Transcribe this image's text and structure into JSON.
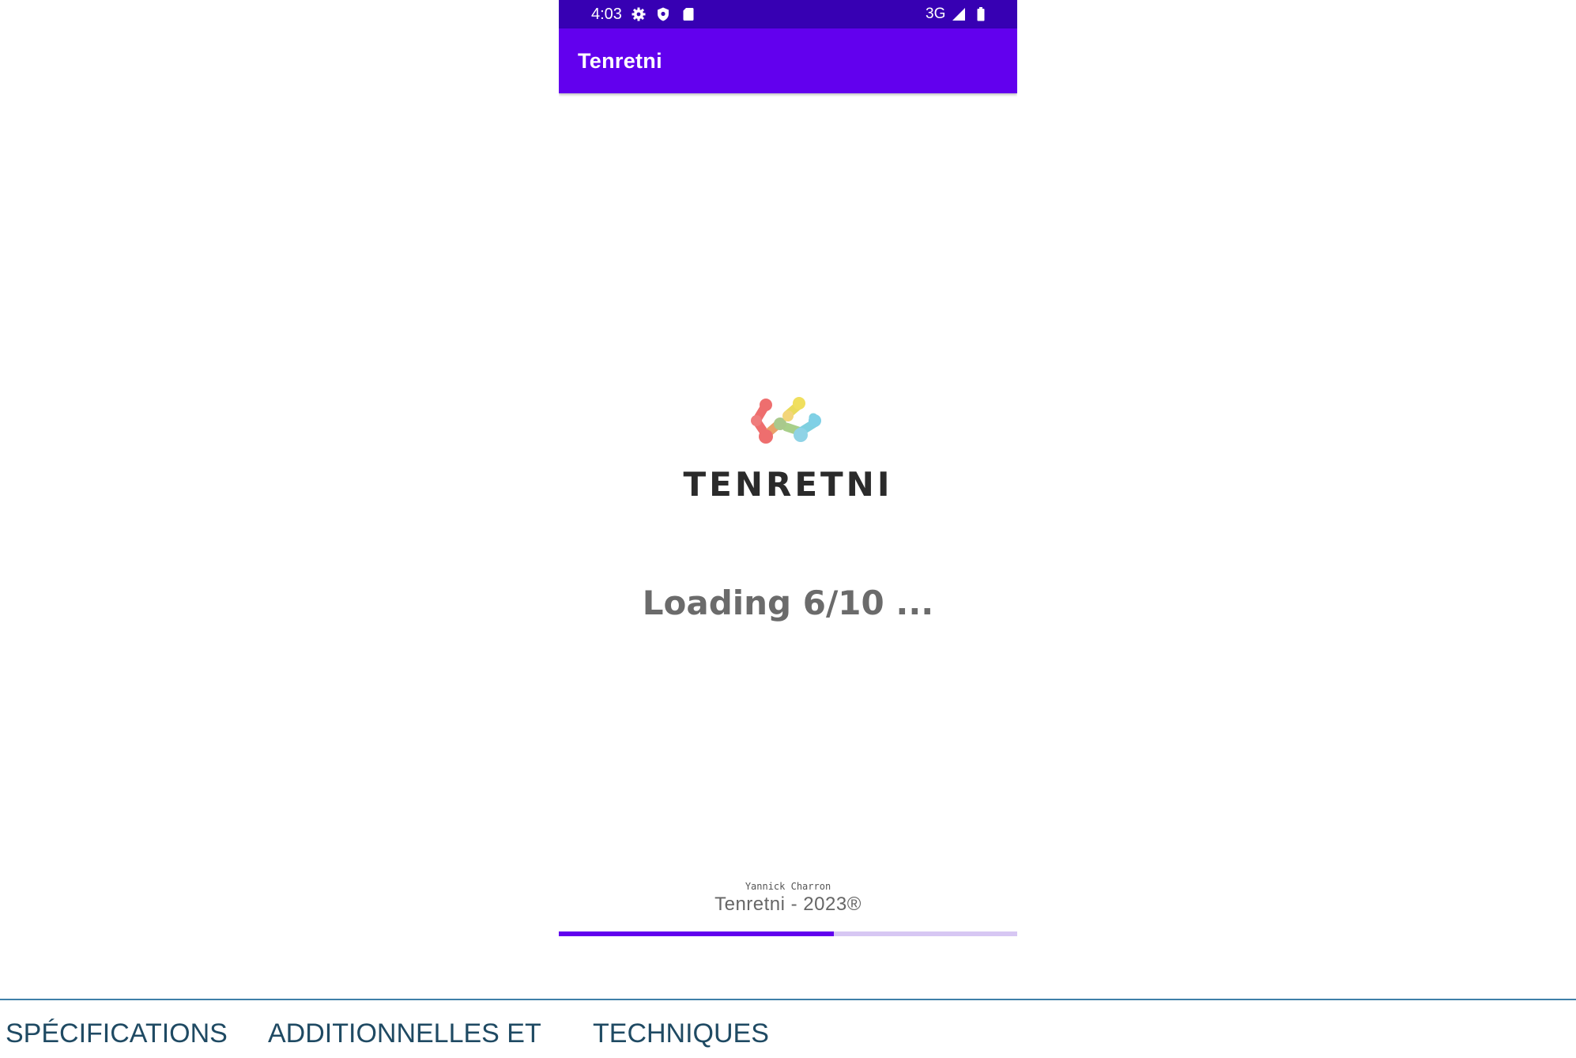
{
  "status_bar": {
    "time": "4:03",
    "icons_left": [
      "settings-icon",
      "shield-icon",
      "sd-card-icon"
    ],
    "network": "3G",
    "icons_right": [
      "signal-icon",
      "battery-icon"
    ]
  },
  "app_bar": {
    "title": "Tenretni"
  },
  "splash": {
    "logo_text": "TENRETNI",
    "loading_text": "Loading 6/10 ...",
    "author": "Yannick Charron",
    "copyright": "Tenretni - 2023®"
  },
  "progress": {
    "current": 6,
    "total": 10,
    "fraction": 0.6
  },
  "document": {
    "heading_words": [
      "SPÉCIFICATIONS",
      "ADDITIONNELLES ET",
      "TECHNIQUES"
    ]
  },
  "colors": {
    "status_bar": "#3700b3",
    "app_bar": "#6200ee",
    "progress_fill": "#6200ee",
    "progress_track": "#d7c7f3",
    "heading": "#1f4a63",
    "rule": "#3f7fa8"
  }
}
